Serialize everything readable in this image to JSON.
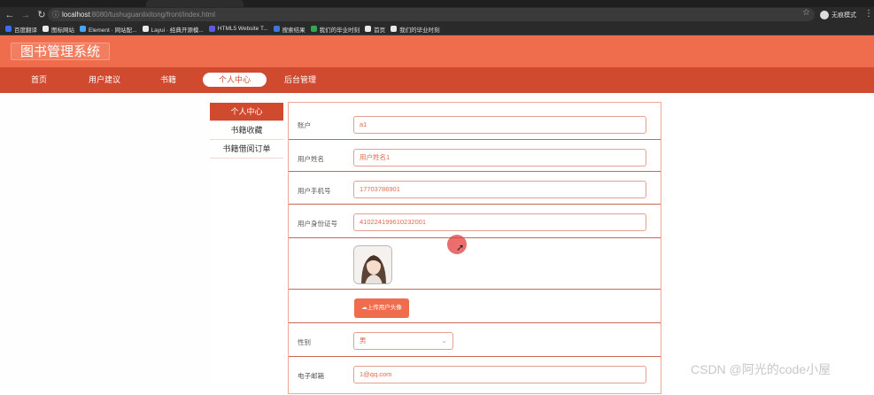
{
  "browser": {
    "url_host": "localhost",
    "url_rest": ":8080/tushuguanlixitong/front/index.html",
    "profile_label": "无痕模式",
    "bookmarks": [
      {
        "label": "百度翻译",
        "color": "#3b6cf5"
      },
      {
        "label": "图标网站",
        "color": "#e9e9e9"
      },
      {
        "label": "Element · 网站配...",
        "color": "#4aa3f0"
      },
      {
        "label": "Layui · 经典开源模...",
        "color": "#e9e9e9"
      },
      {
        "label": "HTML5 Website T...",
        "color": "#5b5be0"
      },
      {
        "label": "搜索结果",
        "color": "#3c78d8"
      },
      {
        "label": "我们的毕业时刻",
        "color": "#2fa84f"
      },
      {
        "label": "首页",
        "color": "#e9e9e9"
      },
      {
        "label": "我们的毕业时刻",
        "color": "#e9e9e9"
      }
    ]
  },
  "site": {
    "logo": "图书管理系统",
    "nav": [
      "首页",
      "用户建议",
      "书籍",
      "个人中心",
      "后台管理"
    ]
  },
  "sidemenu": [
    "个人中心",
    "书籍收藏",
    "书籍借阅订单"
  ],
  "form": {
    "account_label": "账户",
    "account_value": "a1",
    "name_label": "用户姓名",
    "name_value": "用户姓名1",
    "phone_label": "用户手机号",
    "phone_value": "17703786901",
    "idcard_label": "用户身份证号",
    "idcard_value": "410224199610232001",
    "upload_label": "上传用户头像",
    "gender_label": "性别",
    "gender_value": "男",
    "email_label": "电子邮箱",
    "email_value": "1@qq.com"
  },
  "watermark": "CSDN @阿光的code小屋",
  "colors": {
    "header": "#ef6d4c",
    "navbar": "#cf4a2f",
    "accent": "#e26a4c"
  }
}
